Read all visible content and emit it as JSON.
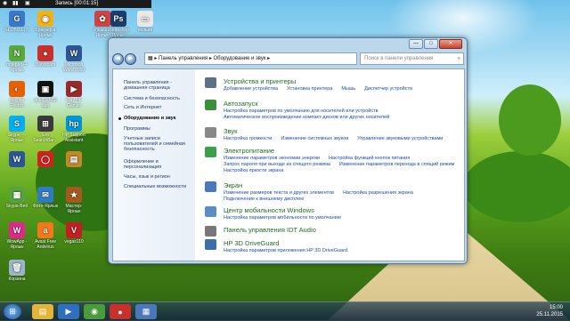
{
  "recorder": {
    "label": "Запись [00:01:15]"
  },
  "desktop_icons": [
    {
      "label": "GLOBUS (2)",
      "color": "#3a78c8",
      "glyph": "G"
    },
    {
      "label": "Браузер в Ярлык",
      "color": "#f0b21a",
      "glyph": "◉"
    },
    {
      "label": "Picasa 3 Ярлык",
      "color": "#cc4444",
      "glyph": "✿"
    },
    {
      "label": "Photoshop Ярлык",
      "color": "#1c3d6b",
      "glyph": "Ps"
    },
    {
      "label": "польин",
      "color": "#e8e8e8",
      "glyph": "▭"
    },
    {
      "label": "notepad++ Ярлык",
      "color": "#59a83a",
      "glyph": "N"
    },
    {
      "label": "Bandicam",
      "color": "#c9302c",
      "glyph": "●"
    },
    {
      "label": "Microsoft Word 2010",
      "color": "#2b5797",
      "glyph": "W"
    },
    {
      "label": "Mozilla Firefox",
      "color": "#e66000",
      "glyph": "◐"
    },
    {
      "label": "autoDENGI app",
      "color": "#111111",
      "glyph": "▣"
    },
    {
      "label": "Play HF Games",
      "color": "#9a2a2a",
      "glyph": "▶"
    },
    {
      "label": "Skype — Ярлык",
      "color": "#00aff0",
      "glyph": "S"
    },
    {
      "label": "Ent SearchBar...",
      "color": "#3a3a3a",
      "glyph": "⊞"
    },
    {
      "label": "HP Support Assistant",
      "color": "#0096d6",
      "glyph": "hp"
    },
    {
      "label": "",
      "color": "#2b5797",
      "glyph": "W"
    },
    {
      "label": "",
      "color": "#d2231b",
      "glyph": "◯"
    },
    {
      "label": "",
      "color": "#c08a2a",
      "glyph": "▤"
    },
    {
      "label": "Skype-Веб",
      "color": "#57a43e",
      "glyph": "▦"
    },
    {
      "label": "Фото-Ярлык",
      "color": "#2f7cc0",
      "glyph": "✉"
    },
    {
      "label": "Мастер-Ярлык",
      "color": "#a45a1e",
      "glyph": "★"
    },
    {
      "label": "WowApp - Ярлык",
      "color": "#e0288a",
      "glyph": "W"
    },
    {
      "label": "Avast Free Antivirus",
      "color": "#f07a1a",
      "glyph": "a"
    },
    {
      "label": "vegas110",
      "color": "#c02020",
      "glyph": "V"
    },
    {
      "label": "Корзина",
      "color": "#9bb6c9",
      "glyph": "🗑"
    }
  ],
  "window": {
    "title": "",
    "buttons": {
      "minimize": "—",
      "maximize": "□",
      "close": "✕"
    },
    "nav": {
      "back": "◀",
      "forward": "▶"
    },
    "address": [
      "Панель управления",
      "Оборудование и звук"
    ],
    "search_placeholder": "Поиск в панели управления"
  },
  "sidebar": {
    "items": [
      {
        "label": "Панель управления - домашняя страница"
      },
      {
        "label": "Система и безопасность"
      },
      {
        "label": "Сеть и Интернет"
      },
      {
        "label": "Оборудование и звук",
        "current": true
      },
      {
        "label": "Программы"
      },
      {
        "label": "Учетные записи пользователей и семейная безопасность"
      },
      {
        "label": "Оформление и персонализация"
      },
      {
        "label": "Часы, язык и регион"
      },
      {
        "label": "Специальные возможности"
      }
    ]
  },
  "sections": [
    {
      "title": "Устройства и принтеры",
      "icon_color": "#5c7088",
      "rows": [
        [
          "Добавление устройства",
          "Установка принтера",
          "Мышь",
          "Диспетчер устройств"
        ]
      ]
    },
    {
      "title": "Автозапуск",
      "icon_color": "#3b8f3b",
      "rows": [
        [
          "Настройка параметров по умолчанию для носителей или устройств"
        ],
        [
          "Автоматическое воспроизведение компакт-дисков или других носителей"
        ]
      ]
    },
    {
      "title": "Звук",
      "icon_color": "#888888",
      "rows": [
        [
          "Настройка громкости",
          "Изменение системных звуков",
          "Управление звуковыми устройствами"
        ]
      ]
    },
    {
      "title": "Электропитание",
      "icon_color": "#3aa04a",
      "rows": [
        [
          "Изменение параметров экономии энергии",
          "Настройка функций кнопок питания"
        ],
        [
          "Запрос пароля при выходе из спящего режима",
          "Изменение параметров перехода в спящий режим"
        ],
        [
          "Настройка яркости экрана"
        ]
      ]
    },
    {
      "title": "Экран",
      "icon_color": "#4a78b8",
      "rows": [
        [
          "Изменение размеров текста и других элементов",
          "Настройка разрешения экрана"
        ],
        [
          "Подключение к внешнему дисплею"
        ]
      ]
    },
    {
      "title": "Центр мобильности Windows",
      "icon_color": "#5b8cc4",
      "rows": [
        [
          "Настройка параметров мобильности по умолчанию"
        ]
      ]
    },
    {
      "title": "Панель управления IDT Audio",
      "icon_color": "#777777",
      "rows": []
    },
    {
      "title": "HP 3D DriveGuard",
      "icon_color": "#3c6ea8",
      "rows": [
        [
          "Настройка параметров приложения HP 3D DriveGuard."
        ]
      ]
    }
  ],
  "taskbar": {
    "start_icon": "⊞",
    "items": [
      {
        "name": "folder",
        "color": "#e2b43a",
        "glyph": "▤"
      },
      {
        "name": "media",
        "color": "#2f6fbf",
        "glyph": "▶"
      },
      {
        "name": "chrome",
        "color": "#4a9b3a",
        "glyph": "◉"
      },
      {
        "name": "bandicam",
        "color": "#c9302c",
        "glyph": "●"
      },
      {
        "name": "control-panel",
        "color": "#4a78b8",
        "glyph": "▦"
      }
    ],
    "time": "15:00",
    "date": "25.11.2015"
  },
  "colors": {
    "accent_link": "#1b4bb0",
    "section_head": "#1e6e22"
  }
}
